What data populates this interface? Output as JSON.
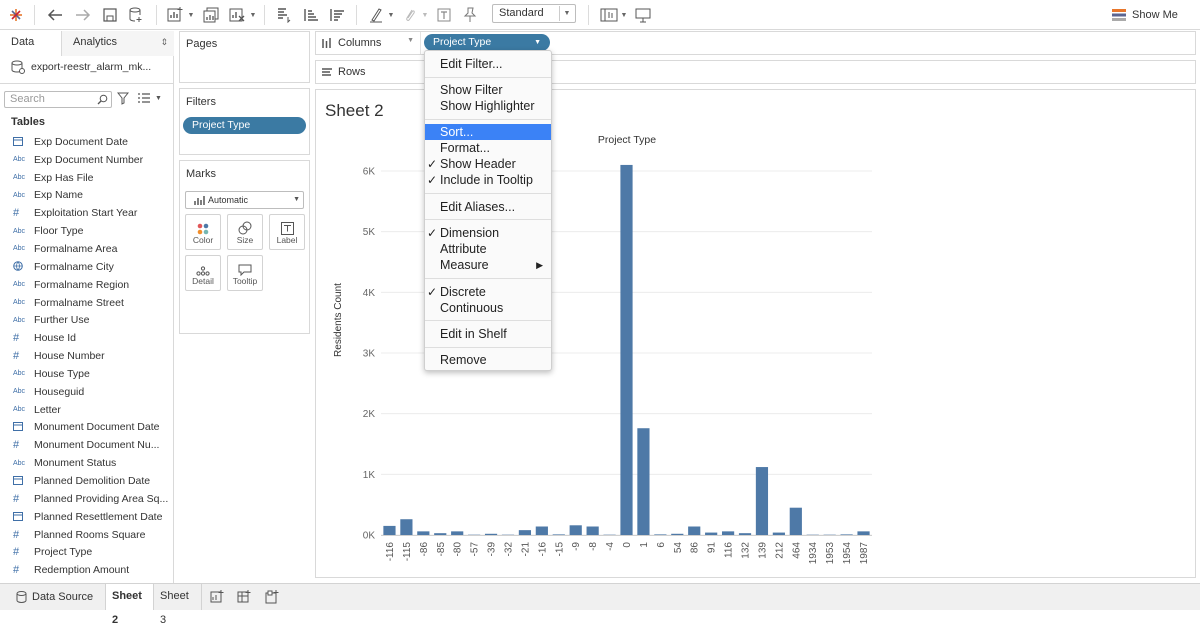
{
  "toolbar": {
    "fit_mode": "Standard",
    "show_me": "Show Me"
  },
  "left_panel": {
    "tab_data": "Data",
    "tab_analytics": "Analytics",
    "datasource_name": "export-reestr_alarm_mk...",
    "search_placeholder": "Search",
    "tables_heading": "Tables",
    "fields": [
      {
        "type": "date",
        "name": "Exp Document Date"
      },
      {
        "type": "Abc",
        "name": "Exp Document Number"
      },
      {
        "type": "Abc",
        "name": "Exp Has File"
      },
      {
        "type": "Abc",
        "name": "Exp Name"
      },
      {
        "type": "#",
        "name": "Exploitation Start Year"
      },
      {
        "type": "Abc",
        "name": "Floor Type"
      },
      {
        "type": "Abc",
        "name": "Formalname Area"
      },
      {
        "type": "globe",
        "name": "Formalname City"
      },
      {
        "type": "Abc",
        "name": "Formalname Region"
      },
      {
        "type": "Abc",
        "name": "Formalname Street"
      },
      {
        "type": "Abc",
        "name": "Further Use"
      },
      {
        "type": "#",
        "name": "House Id"
      },
      {
        "type": "#",
        "name": "House Number"
      },
      {
        "type": "Abc",
        "name": "House Type"
      },
      {
        "type": "Abc",
        "name": "Houseguid"
      },
      {
        "type": "Abc",
        "name": "Letter"
      },
      {
        "type": "date",
        "name": "Monument Document Date"
      },
      {
        "type": "#",
        "name": "Monument Document Nu..."
      },
      {
        "type": "Abc",
        "name": "Monument Status"
      },
      {
        "type": "date",
        "name": "Planned Demolition Date"
      },
      {
        "type": "#",
        "name": "Planned Providing Area Sq..."
      },
      {
        "type": "date",
        "name": "Planned Resettlement Date"
      },
      {
        "type": "#",
        "name": "Planned Rooms Square"
      },
      {
        "type": "#",
        "name": "Project Type"
      },
      {
        "type": "#",
        "name": "Redemption Amount"
      }
    ]
  },
  "cards": {
    "pages": "Pages",
    "filters": "Filters",
    "filter_pill": "Project Type",
    "marks": "Marks",
    "mark_type": "Automatic",
    "mark_buttons": [
      "Color",
      "Size",
      "Label",
      "Detail",
      "Tooltip"
    ]
  },
  "shelves": {
    "columns": "Columns",
    "rows": "Rows",
    "column_pill": "Project Type"
  },
  "context_menu": {
    "items": [
      {
        "label": "Edit Filter...",
        "checked": false
      },
      {
        "label": "Show Filter",
        "checked": false
      },
      {
        "label": "Show Highlighter",
        "checked": false
      },
      {
        "label": "Sort...",
        "checked": false,
        "highlighted": true
      },
      {
        "label": "Format...",
        "checked": false
      },
      {
        "label": "Show Header",
        "checked": true
      },
      {
        "label": "Include in Tooltip",
        "checked": true
      },
      {
        "label": "Edit Aliases...",
        "checked": false
      },
      {
        "label": "Dimension",
        "checked": true
      },
      {
        "label": "Attribute",
        "checked": false
      },
      {
        "label": "Measure",
        "checked": false,
        "submenu": true
      },
      {
        "label": "Discrete",
        "checked": true
      },
      {
        "label": "Continuous",
        "checked": false
      },
      {
        "label": "Edit in Shelf",
        "checked": false
      },
      {
        "label": "Remove",
        "checked": false
      }
    ]
  },
  "sheet": {
    "title": "Sheet 2"
  },
  "chart_data": {
    "type": "bar",
    "title": "Project Type",
    "xlabel": "",
    "ylabel": "Residents Count",
    "ylim": [
      0,
      6000
    ],
    "yticks": [
      "0K",
      "1K",
      "2K",
      "3K",
      "4K",
      "5K",
      "6K"
    ],
    "bar_color": "#4e79a7",
    "grid": true,
    "categories": [
      "-116",
      "-115",
      "-86",
      "-85",
      "-80",
      "-57",
      "-39",
      "-32",
      "-21",
      "-16",
      "-15",
      "-9",
      "-8",
      "-4",
      "0",
      "1",
      "6",
      "54",
      "86",
      "91",
      "116",
      "132",
      "139",
      "212",
      "464",
      "1934",
      "1953",
      "1954",
      "1987"
    ],
    "values": [
      150,
      260,
      60,
      30,
      60,
      5,
      20,
      5,
      80,
      140,
      10,
      160,
      140,
      5,
      6100,
      1760,
      10,
      20,
      140,
      40,
      60,
      30,
      1120,
      40,
      450,
      5,
      5,
      10,
      60
    ]
  },
  "bottom": {
    "data_source": "Data Source",
    "tabs": [
      "Sheet 2",
      "Sheet 3"
    ]
  },
  "colors": {
    "accent_pill": "#3b7aa3",
    "menu_highlight": "#3b82f6",
    "bar": "#4e79a7"
  }
}
